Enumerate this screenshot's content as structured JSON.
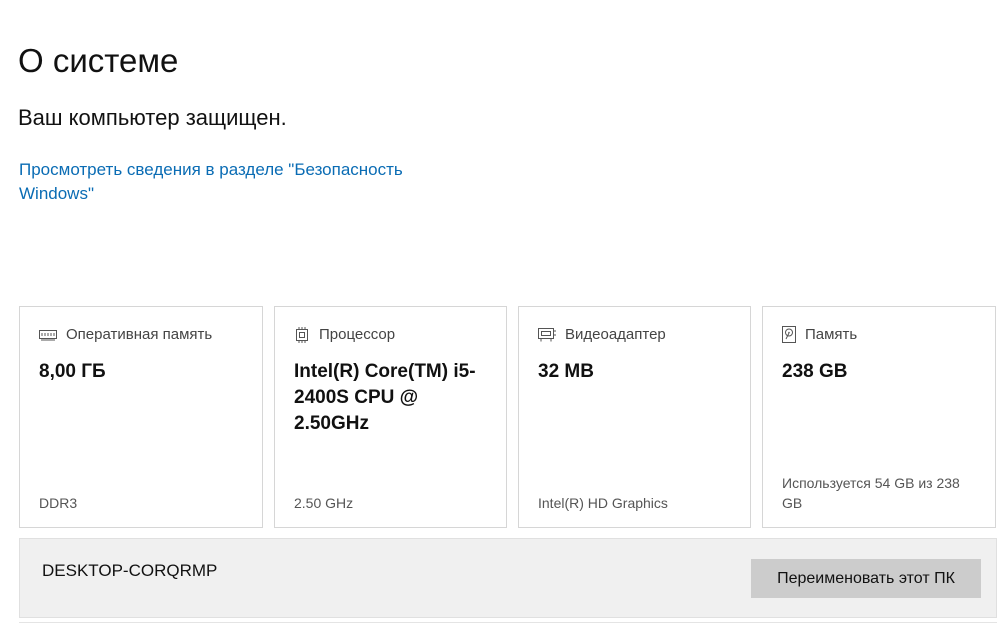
{
  "page": {
    "title": "О системе",
    "protection_status": "Ваш компьютер защищен.",
    "security_link": "Просмотреть сведения в разделе \"Безопасность Windows\""
  },
  "cards": [
    {
      "icon": "ram-icon",
      "label": "Оперативная память",
      "value": "8,00 ГБ",
      "footer": "DDR3"
    },
    {
      "icon": "cpu-icon",
      "label": "Процессор",
      "value": "Intel(R) Core(TM) i5-2400S CPU @ 2.50GHz",
      "footer": "2.50 GHz"
    },
    {
      "icon": "display-adapter-icon",
      "label": "Видеоадаптер",
      "value": "32 MB",
      "footer": "Intel(R) HD Graphics"
    },
    {
      "icon": "storage-icon",
      "label": "Память",
      "value": "238 GB",
      "footer": "Используется 54 GB из 238 GB"
    }
  ],
  "device": {
    "name": "DESKTOP-CORQRMP",
    "rename_button": "Переименовать этот ПК"
  },
  "colors": {
    "link": "#0a6cb4",
    "card_border": "#d6d6d6",
    "button_bg": "#cccccc",
    "device_bar_bg": "#f0f0f0"
  }
}
